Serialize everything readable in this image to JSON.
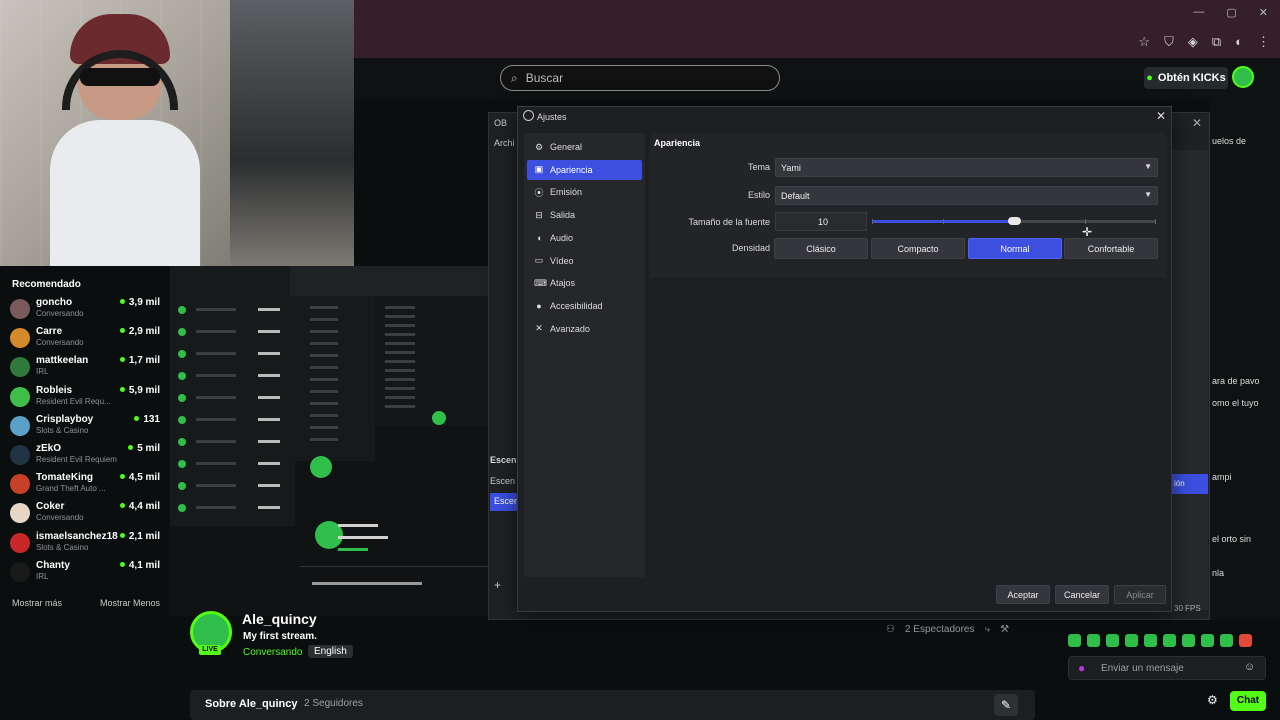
{
  "browser": {
    "search_placeholder": "Buscar",
    "kicks_label": "Obtén KICKs"
  },
  "recommended": {
    "title": "Recomendado",
    "items": [
      {
        "name": "goncho",
        "category": "Conversando",
        "viewers": "3,9 mil",
        "color": "#7a5a5a"
      },
      {
        "name": "Carre",
        "category": "Conversando",
        "viewers": "2,9 mil",
        "color": "#d48a2a"
      },
      {
        "name": "mattkeelan",
        "category": "IRL",
        "viewers": "1,7 mil",
        "color": "#2f7a3a"
      },
      {
        "name": "Robleis",
        "category": "Resident Evil Requ...",
        "viewers": "5,9 mil",
        "color": "#3fbf4a"
      },
      {
        "name": "Crisplayboy",
        "category": "Slots & Casino",
        "viewers": "131",
        "color": "#5aa0c8"
      },
      {
        "name": "zEkO",
        "category": "Resident Evil Requiem",
        "viewers": "5 mil",
        "color": "#223344"
      },
      {
        "name": "TomateKing",
        "category": "Grand Theft Auto ...",
        "viewers": "4,5 mil",
        "color": "#c8402a"
      },
      {
        "name": "Coker",
        "category": "Conversando",
        "viewers": "4,4 mil",
        "color": "#e6d6c6"
      },
      {
        "name": "ismaelsanchez18",
        "category": "Slots & Casino",
        "viewers": "2,1 mil",
        "color": "#c8282a"
      },
      {
        "name": "Chanty",
        "category": "IRL",
        "viewers": "4,1 mil",
        "color": "#1a1a1a"
      }
    ],
    "show_more": "Mostrar más",
    "show_less": "Mostrar Menos"
  },
  "stream": {
    "live_badge": "LIVE",
    "streamer": "Ale_quincy",
    "title": "My first stream.",
    "category": "Conversando",
    "language": "English",
    "viewers": "2 Espectadores",
    "about_label": "Sobre Ale_quincy",
    "followers": "2 Seguidores"
  },
  "chat": {
    "fragments": [
      "uelos de",
      "ara de pavo",
      "omo el tuyo",
      "ampi",
      "el orto sin",
      "nla"
    ],
    "input_placeholder": "Enviar un mensaje",
    "chat_button": "Chat"
  },
  "obs": {
    "title_fragment": "OB",
    "menu_fragment": "Archi",
    "dock_label_a": "Escen",
    "dock_label_b": "Escen",
    "dock_label_c": "Escen",
    "right_sel": "ión",
    "fps": "30 FPS"
  },
  "settings": {
    "title": "Ajustes",
    "nav": [
      {
        "label": "General",
        "icon": "gear-icon",
        "glyph": "⚙"
      },
      {
        "label": "Apariencia",
        "icon": "palette-icon",
        "glyph": "▣"
      },
      {
        "label": "Emisión",
        "icon": "broadcast-icon",
        "glyph": "⦿"
      },
      {
        "label": "Salida",
        "icon": "output-icon",
        "glyph": "⊟"
      },
      {
        "label": "Audio",
        "icon": "speaker-icon",
        "glyph": "◖"
      },
      {
        "label": "Vídeo",
        "icon": "monitor-icon",
        "glyph": "▭"
      },
      {
        "label": "Atajos",
        "icon": "keyboard-icon",
        "glyph": "⌨"
      },
      {
        "label": "Accesibilidad",
        "icon": "accessibility-icon",
        "glyph": "●"
      },
      {
        "label": "Avanzado",
        "icon": "tools-icon",
        "glyph": "✕"
      }
    ],
    "active_nav": "Apariencia",
    "section_title": "Apariencia",
    "theme_label": "Tema",
    "theme_value": "Yami",
    "style_label": "Estilo",
    "style_value": "Default",
    "font_size_label": "Tamaño de la fuente",
    "font_size_value": "10",
    "font_size_fraction": 0.5,
    "density_label": "Densidad",
    "density_options": [
      "Clásico",
      "Compacto",
      "Normal",
      "Confortable"
    ],
    "density_selected": "Normal",
    "accept": "Aceptar",
    "cancel": "Cancelar",
    "apply": "Aplicar"
  },
  "colors": {
    "kick_green": "#53fc18",
    "obs_accent": "#3c4fe0"
  }
}
